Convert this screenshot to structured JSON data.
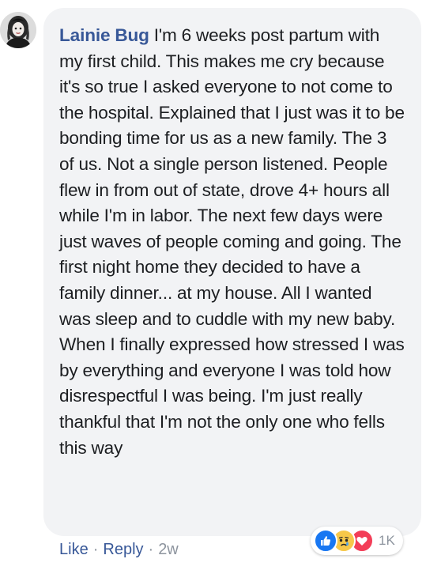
{
  "comment": {
    "author_name": "Lainie Bug",
    "text": "I'm 6 weeks post partum with my first child. This makes me cry because it's so true I asked everyone to not come to the hospital. Explained that I just was it to be bonding time for us as a new family. The 3 of us. Not a single person listened. People flew in from out of state, drove 4+ hours all while I'm in labor. The next few days were just waves of people coming and going. The first night home they decided to have a family dinner... at my house. All I wanted was sleep and to cuddle with my new baby. When I finally expressed how stressed I was by everything and everyone I was told how disrespectful I was being. I'm just really thankful that I'm not the only one who fells this way"
  },
  "reactions": {
    "types": [
      "like-icon",
      "sad-icon",
      "love-icon"
    ],
    "count": "1K",
    "colors": {
      "like": "#1877f2",
      "sad": "#f7c84a",
      "love": "#f33e58"
    }
  },
  "actions": {
    "like_label": "Like",
    "separator": "·",
    "reply_label": "Reply",
    "timestamp": "2w"
  },
  "colors": {
    "bubble_bg": "#f2f3f5",
    "author_link": "#385898",
    "body_text": "#1c1e21",
    "meta_text": "#8d949e"
  }
}
